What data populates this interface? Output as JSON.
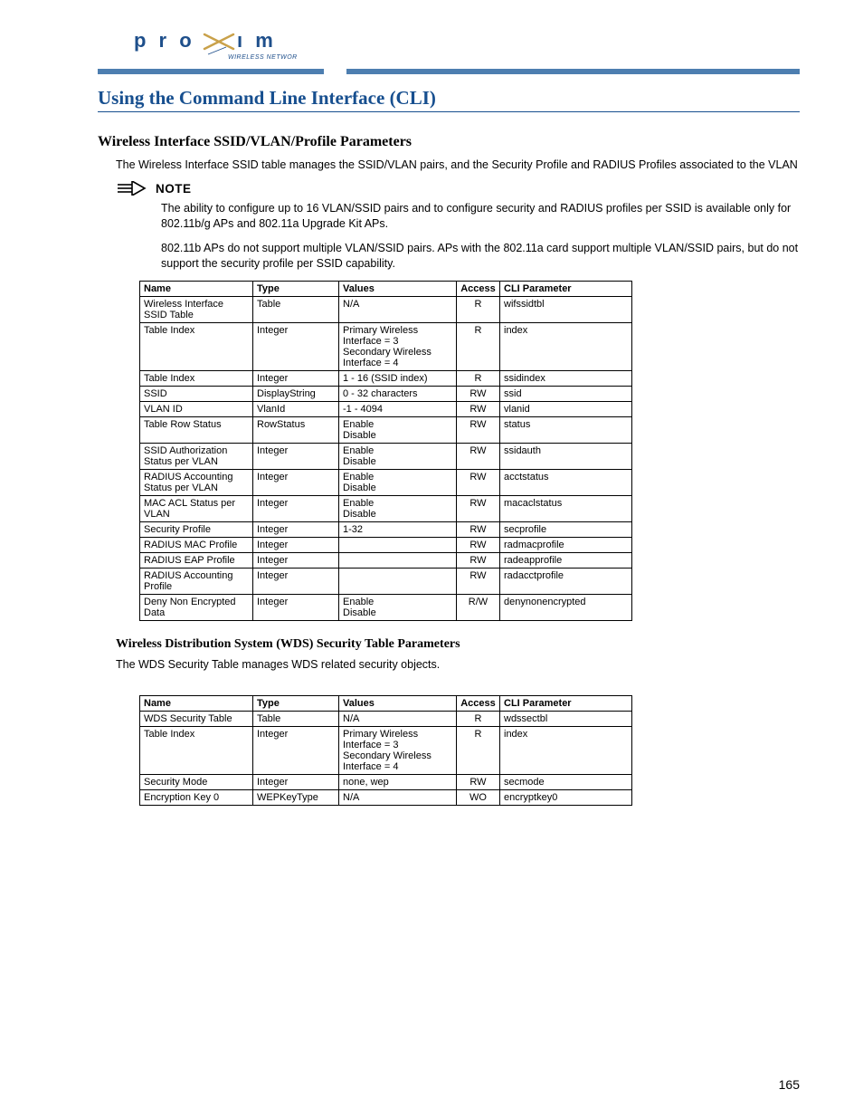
{
  "logo": {
    "text_main": "proxim",
    "text_sub": "WIRELESS NETWORKS"
  },
  "page_title": "Using the Command Line Interface (CLI)",
  "section1": {
    "heading": "Wireless Interface SSID/VLAN/Profile Parameters",
    "intro": "The Wireless Interface SSID table manages the SSID/VLAN pairs, and the Security Profile and RADIUS Profiles associated to the VLAN",
    "note_label": "NOTE",
    "note_p1": "The ability to configure up to 16 VLAN/SSID pairs and to configure security and RADIUS profiles per SSID is available only for  802.11b/g APs and 802.11a Upgrade Kit APs.",
    "note_p2": "802.11b APs do not support multiple VLAN/SSID pairs. APs with the 802.11a card support multiple VLAN/SSID pairs, but do not support the security profile per SSID capability.",
    "table": {
      "headers": [
        "Name",
        "Type",
        "Values",
        "Access",
        "CLI Parameter"
      ],
      "rows": [
        [
          "Wireless Interface SSID Table",
          "Table",
          "N/A",
          "R",
          "wifssidtbl"
        ],
        [
          "Table Index",
          "Integer",
          "Primary Wireless Interface = 3\nSecondary Wireless Interface = 4",
          "R",
          "index"
        ],
        [
          "Table Index",
          "Integer",
          "1 - 16 (SSID index)",
          "R",
          "ssidindex"
        ],
        [
          "SSID",
          "DisplayString",
          "0 - 32 characters",
          "RW",
          "ssid"
        ],
        [
          "VLAN ID",
          "VlanId",
          "-1 - 4094",
          "RW",
          "vlanid"
        ],
        [
          "Table Row Status",
          "RowStatus",
          "Enable\nDisable",
          "RW",
          "status"
        ],
        [
          "SSID Authorization Status per VLAN",
          "Integer",
          "Enable\nDisable",
          "RW",
          "ssidauth"
        ],
        [
          "RADIUS Accounting Status per VLAN",
          "Integer",
          "Enable\nDisable",
          "RW",
          "acctstatus"
        ],
        [
          "MAC ACL Status per VLAN",
          "Integer",
          "Enable\nDisable",
          "RW",
          "macaclstatus"
        ],
        [
          "Security Profile",
          "Integer",
          "1-32",
          "RW",
          "secprofile"
        ],
        [
          "RADIUS MAC Profile",
          "Integer",
          "",
          "RW",
          "radmacprofile"
        ],
        [
          "RADIUS EAP Profile",
          "Integer",
          "",
          "RW",
          "radeapprofile"
        ],
        [
          "RADIUS Accounting Profile",
          "Integer",
          "",
          "RW",
          "radacctprofile"
        ],
        [
          "Deny Non Encrypted Data",
          "Integer",
          "Enable\nDisable",
          "R/W",
          "denynonencrypted"
        ]
      ]
    }
  },
  "section2": {
    "heading": "Wireless Distribution System (WDS) Security Table Parameters",
    "intro": "The WDS Security Table manages WDS related security objects.",
    "table": {
      "headers": [
        "Name",
        "Type",
        "Values",
        "Access",
        "CLI Parameter"
      ],
      "rows": [
        [
          "WDS Security Table",
          "Table",
          "N/A",
          "R",
          "wdssectbl"
        ],
        [
          "Table Index",
          "Integer",
          "Primary Wireless Interface = 3\nSecondary Wireless Interface = 4",
          "R",
          "index"
        ],
        [
          "Security Mode",
          "Integer",
          "none, wep",
          "RW",
          "secmode"
        ],
        [
          "Encryption Key 0",
          "WEPKeyType",
          "N/A",
          "WO",
          "encryptkey0"
        ]
      ]
    }
  },
  "page_number": "165"
}
